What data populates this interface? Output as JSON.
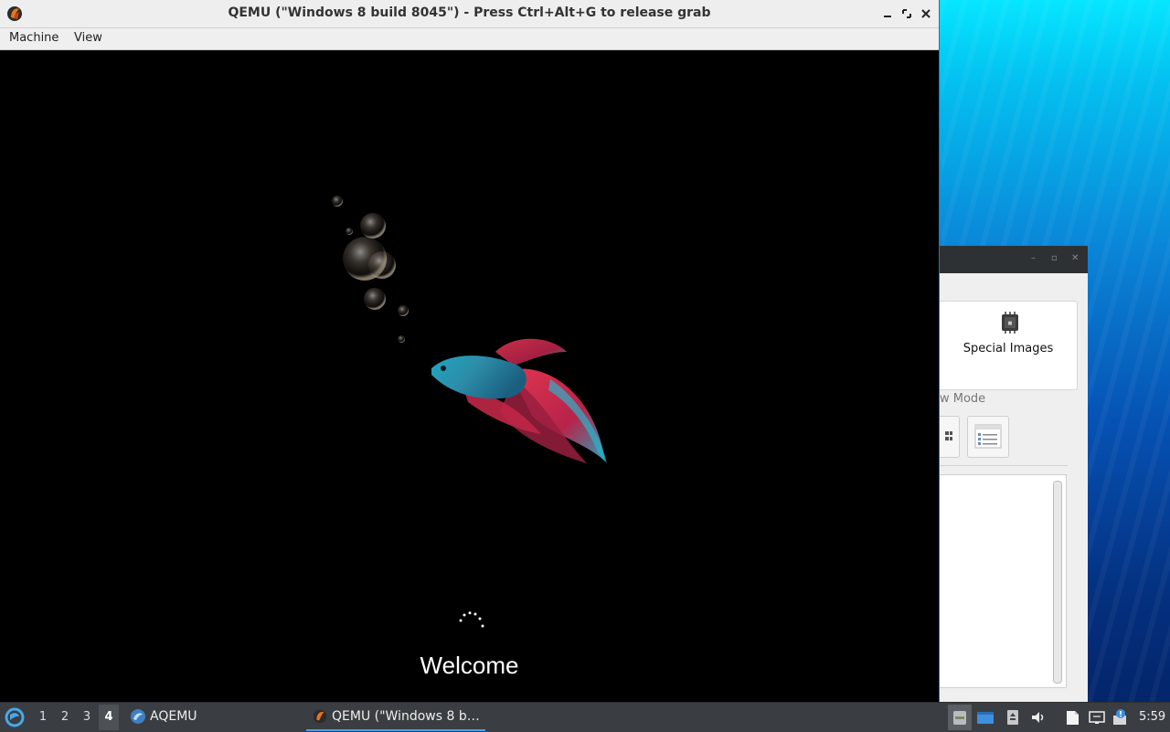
{
  "qemu_window": {
    "title": "QEMU (\"Windows 8 build 8045\") - Press Ctrl+Alt+G to release grab",
    "menu": [
      "Machine",
      "View"
    ],
    "controls": [
      "minimize-icon",
      "maximize-icon",
      "close-icon"
    ]
  },
  "vm_screen": {
    "welcome_text": "Welcome",
    "background_color": "#000000"
  },
  "background_window": {
    "special_images_label": "Special Images",
    "view_mode_label": "w Mode"
  },
  "taskbar": {
    "workspaces": [
      "1",
      "2",
      "3",
      "4"
    ],
    "active_workspace": "4",
    "tasks": [
      {
        "label": "AQEMU",
        "icon": "aqemu-icon"
      },
      {
        "label": "QEMU (\"Windows 8 b…",
        "icon": "qemu-icon",
        "active": true
      }
    ],
    "clock": "5:59"
  },
  "colors": {
    "taskbar_bg": "#3a3e42",
    "accent": "#4a9cf0",
    "titlebar_bg": "#eeeeee"
  }
}
